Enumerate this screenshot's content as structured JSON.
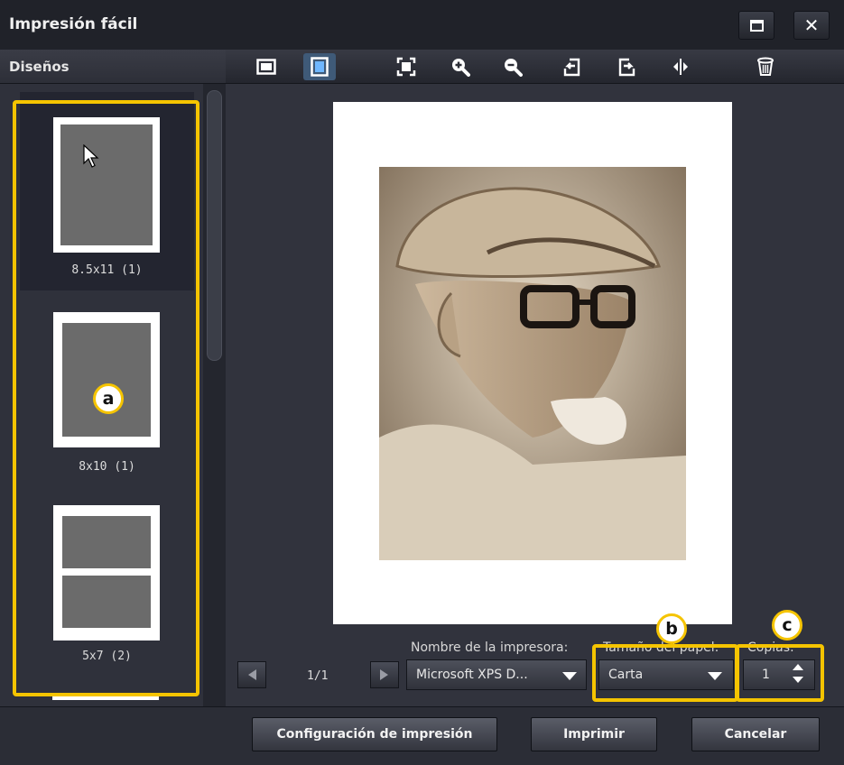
{
  "window": {
    "title": "Impresión fácil"
  },
  "sidebar": {
    "title": "Diseños",
    "layouts": [
      {
        "label": "8.5x11 (1)",
        "photos": 1,
        "selected": true
      },
      {
        "label": "8x10 (1)",
        "photos": 1,
        "selected": false
      },
      {
        "label": "5x7 (2)",
        "photos": 2,
        "selected": false
      }
    ]
  },
  "toolbar": {
    "tools": [
      {
        "icon": "landscape-page-icon",
        "active": false
      },
      {
        "icon": "portrait-page-icon",
        "active": true
      },
      {
        "icon": "fit-to-page-icon",
        "active": false
      },
      {
        "icon": "zoom-in-icon",
        "active": false
      },
      {
        "icon": "zoom-out-icon",
        "active": false
      },
      {
        "icon": "rotate-left-icon",
        "active": false
      },
      {
        "icon": "rotate-right-icon",
        "active": false
      },
      {
        "icon": "flip-horizontal-icon",
        "active": false
      },
      {
        "icon": "trash-icon",
        "active": false
      }
    ]
  },
  "preview": {
    "page_indicator": "1/1"
  },
  "printer": {
    "label": "Nombre de la impresora:",
    "value": "Microsoft XPS D..."
  },
  "paper_size": {
    "label": "Tamaño del papel:",
    "value": "Carta"
  },
  "copies": {
    "label": "Copias:",
    "value": "1"
  },
  "footer": {
    "setup_label": "Configuración de impresión",
    "print_label": "Imprimir",
    "cancel_label": "Cancelar"
  },
  "callouts": {
    "a": "a",
    "b": "b",
    "c": "c",
    "color": "#f5c400"
  },
  "colors": {
    "accent": "#3f5a78",
    "highlight": "#f5c400"
  }
}
